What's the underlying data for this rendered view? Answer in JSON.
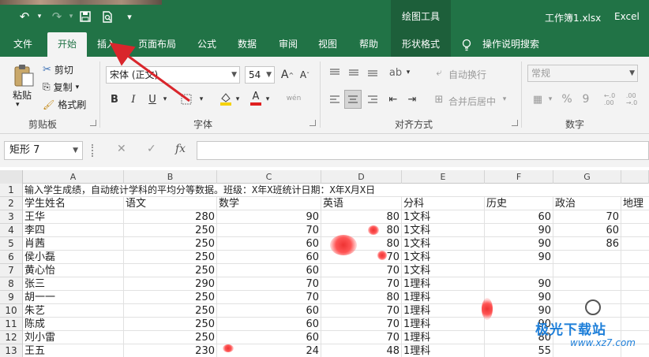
{
  "titlebar": {
    "undo_icon": "undo-icon",
    "redo_icon": "redo-icon",
    "save_icon": "save-icon",
    "preview_icon": "print-preview-icon",
    "customize_icon": "qat-customize-icon",
    "context_title": "绘图工具",
    "filename": "工作簿1.xlsx",
    "app": "Excel"
  },
  "tabs": [
    {
      "label": "文件"
    },
    {
      "label": "开始"
    },
    {
      "label": "插入"
    },
    {
      "label": "页面布局"
    },
    {
      "label": "公式"
    },
    {
      "label": "数据"
    },
    {
      "label": "审阅"
    },
    {
      "label": "视图"
    },
    {
      "label": "帮助"
    },
    {
      "label": "形状格式"
    },
    {
      "label": "操作说明搜索"
    }
  ],
  "ribbon": {
    "clipboard": {
      "paste": "粘贴",
      "cut": "剪切",
      "copy": "复制",
      "format_painter": "格式刷",
      "label": "剪贴板"
    },
    "font": {
      "name": "宋体 (正文)",
      "size": "54",
      "bold": "B",
      "italic": "I",
      "underline": "U",
      "grow": "A",
      "shrink": "A",
      "font_color": "A",
      "phonetic": "wén",
      "label": "字体"
    },
    "alignment": {
      "wrap": "自动换行",
      "merge": "合并后居中",
      "label": "对齐方式"
    },
    "number": {
      "format": "常规",
      "percent": "%",
      "comma": "9",
      "label": "数字"
    }
  },
  "formula": {
    "name_box": "矩形 7",
    "fx": "fx",
    "cancel": "✕",
    "enter": "✓"
  },
  "columns": [
    "A",
    "B",
    "C",
    "D",
    "E",
    "F",
    "G"
  ],
  "rows": [
    {
      "n": "1",
      "cells": {
        "A": "输入学生成绩，自动统计学科的平均分等数据。班级：X年X班统计日期：X年X月X日"
      }
    },
    {
      "n": "2",
      "cells": {
        "A": "学生姓名",
        "B": "语文",
        "C": "数学",
        "D": "英语",
        "E": "分科",
        "F": "历史",
        "G": "政治",
        "H": "地理"
      }
    },
    {
      "n": "3",
      "cells": {
        "A": "王华",
        "B": "280",
        "C": "90",
        "D": "80",
        "E": "1文科",
        "F": "60",
        "G": "70"
      }
    },
    {
      "n": "4",
      "cells": {
        "A": "李四",
        "B": "250",
        "C": "70",
        "D": "80",
        "E": "1文科",
        "F": "90",
        "G": "60"
      }
    },
    {
      "n": "5",
      "cells": {
        "A": "肖茜",
        "B": "250",
        "C": "60",
        "D": "80",
        "E": "1文科",
        "F": "90",
        "G": "86"
      }
    },
    {
      "n": "6",
      "cells": {
        "A": "侯小磊",
        "B": "250",
        "C": "60",
        "D": "70",
        "E": "1文科",
        "F": "90",
        "G": ""
      }
    },
    {
      "n": "7",
      "cells": {
        "A": "黄心怡",
        "B": "250",
        "C": "60",
        "D": "70",
        "E": "1文科",
        "F": "",
        "G": ""
      }
    },
    {
      "n": "8",
      "cells": {
        "A": "张三",
        "B": "290",
        "C": "70",
        "D": "70",
        "E": "1理科",
        "F": "90",
        "G": ""
      }
    },
    {
      "n": "9",
      "cells": {
        "A": "胡一一",
        "B": "250",
        "C": "70",
        "D": "80",
        "E": "1理科",
        "F": "90",
        "G": ""
      }
    },
    {
      "n": "10",
      "cells": {
        "A": "朱艺",
        "B": "250",
        "C": "60",
        "D": "70",
        "E": "1理科",
        "F": "90",
        "G": ""
      }
    },
    {
      "n": "11",
      "cells": {
        "A": "陈成",
        "B": "250",
        "C": "60",
        "D": "70",
        "E": "1理科",
        "F": "90",
        "G": ""
      }
    },
    {
      "n": "12",
      "cells": {
        "A": "刘小雷",
        "B": "250",
        "C": "60",
        "D": "70",
        "E": "1理科",
        "F": "80",
        "G": ""
      }
    },
    {
      "n": "13",
      "cells": {
        "A": "王五",
        "B": "230",
        "C": "24",
        "D": "48",
        "E": "1理科",
        "F": "55",
        "G": ""
      }
    }
  ],
  "watermark": {
    "text": "极光下载站",
    "url": "www.xz7.com"
  },
  "colors": {
    "excel_green": "#217346",
    "arrow_red": "#d9262c"
  }
}
